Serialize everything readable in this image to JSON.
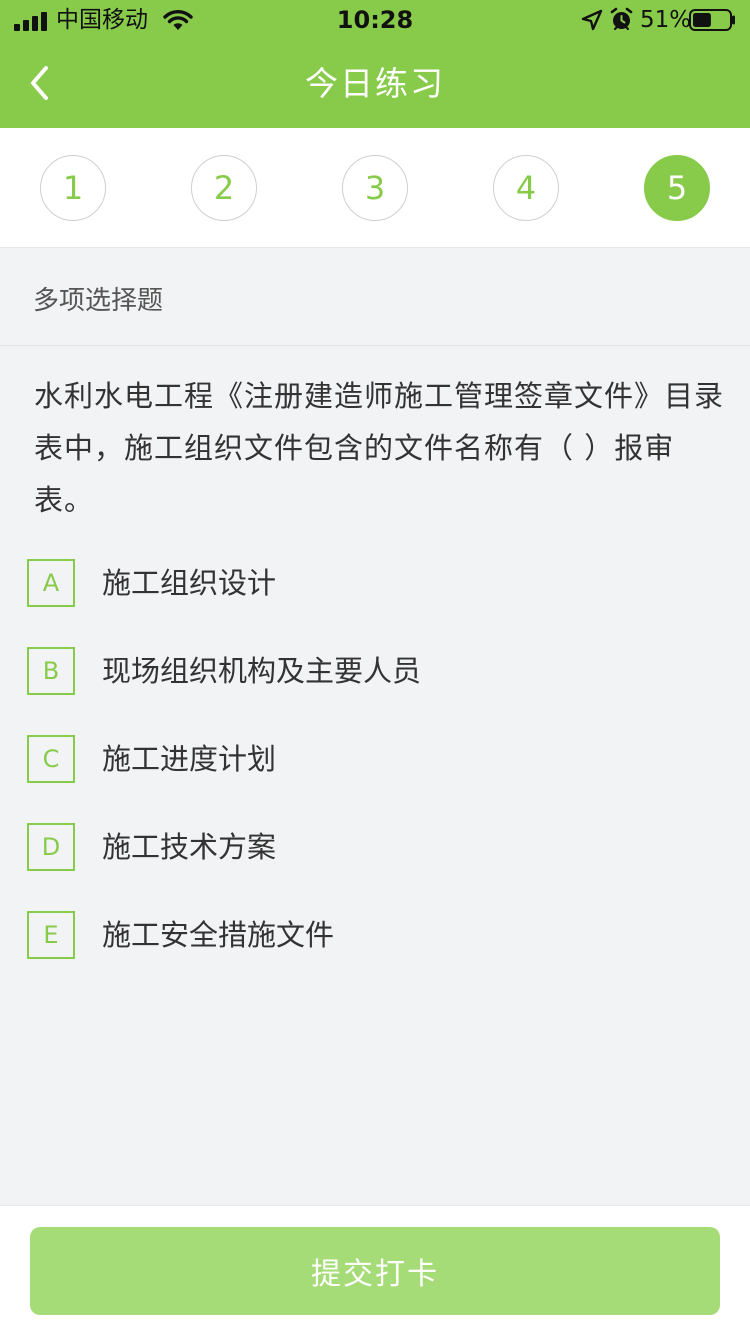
{
  "status_bar": {
    "carrier": "中国移动",
    "time": "10:28",
    "battery": "51%",
    "battery_level": 0.51,
    "icons": [
      "signal-icon",
      "wifi-icon",
      "location-icon",
      "alarm-icon",
      "battery-icon"
    ]
  },
  "nav": {
    "title": "今日练习",
    "back_icon": "chevron-left-icon"
  },
  "steps": {
    "items": [
      "1",
      "2",
      "3",
      "4",
      "5"
    ],
    "active": "5"
  },
  "question": {
    "type": "多项选择题",
    "stem_lines": [
      "水利水电工程《注册建造师施工管理签章文件》目录",
      "表中，施工组织文件包含的文件名称有（    ）报审",
      "表。"
    ],
    "options": [
      {
        "key": "A",
        "text": "施工组织设计"
      },
      {
        "key": "B",
        "text": "现场组织机构及主要人员"
      },
      {
        "key": "C",
        "text": "施工进度计划"
      },
      {
        "key": "D",
        "text": "施工技术方案"
      },
      {
        "key": "E",
        "text": "施工安全措施文件"
      }
    ]
  },
  "footer": {
    "submit_label": "提交打卡"
  },
  "colors": {
    "accent": "#88cb4b",
    "submit_disabled": "#a6dc78",
    "background": "#f2f3f5"
  }
}
